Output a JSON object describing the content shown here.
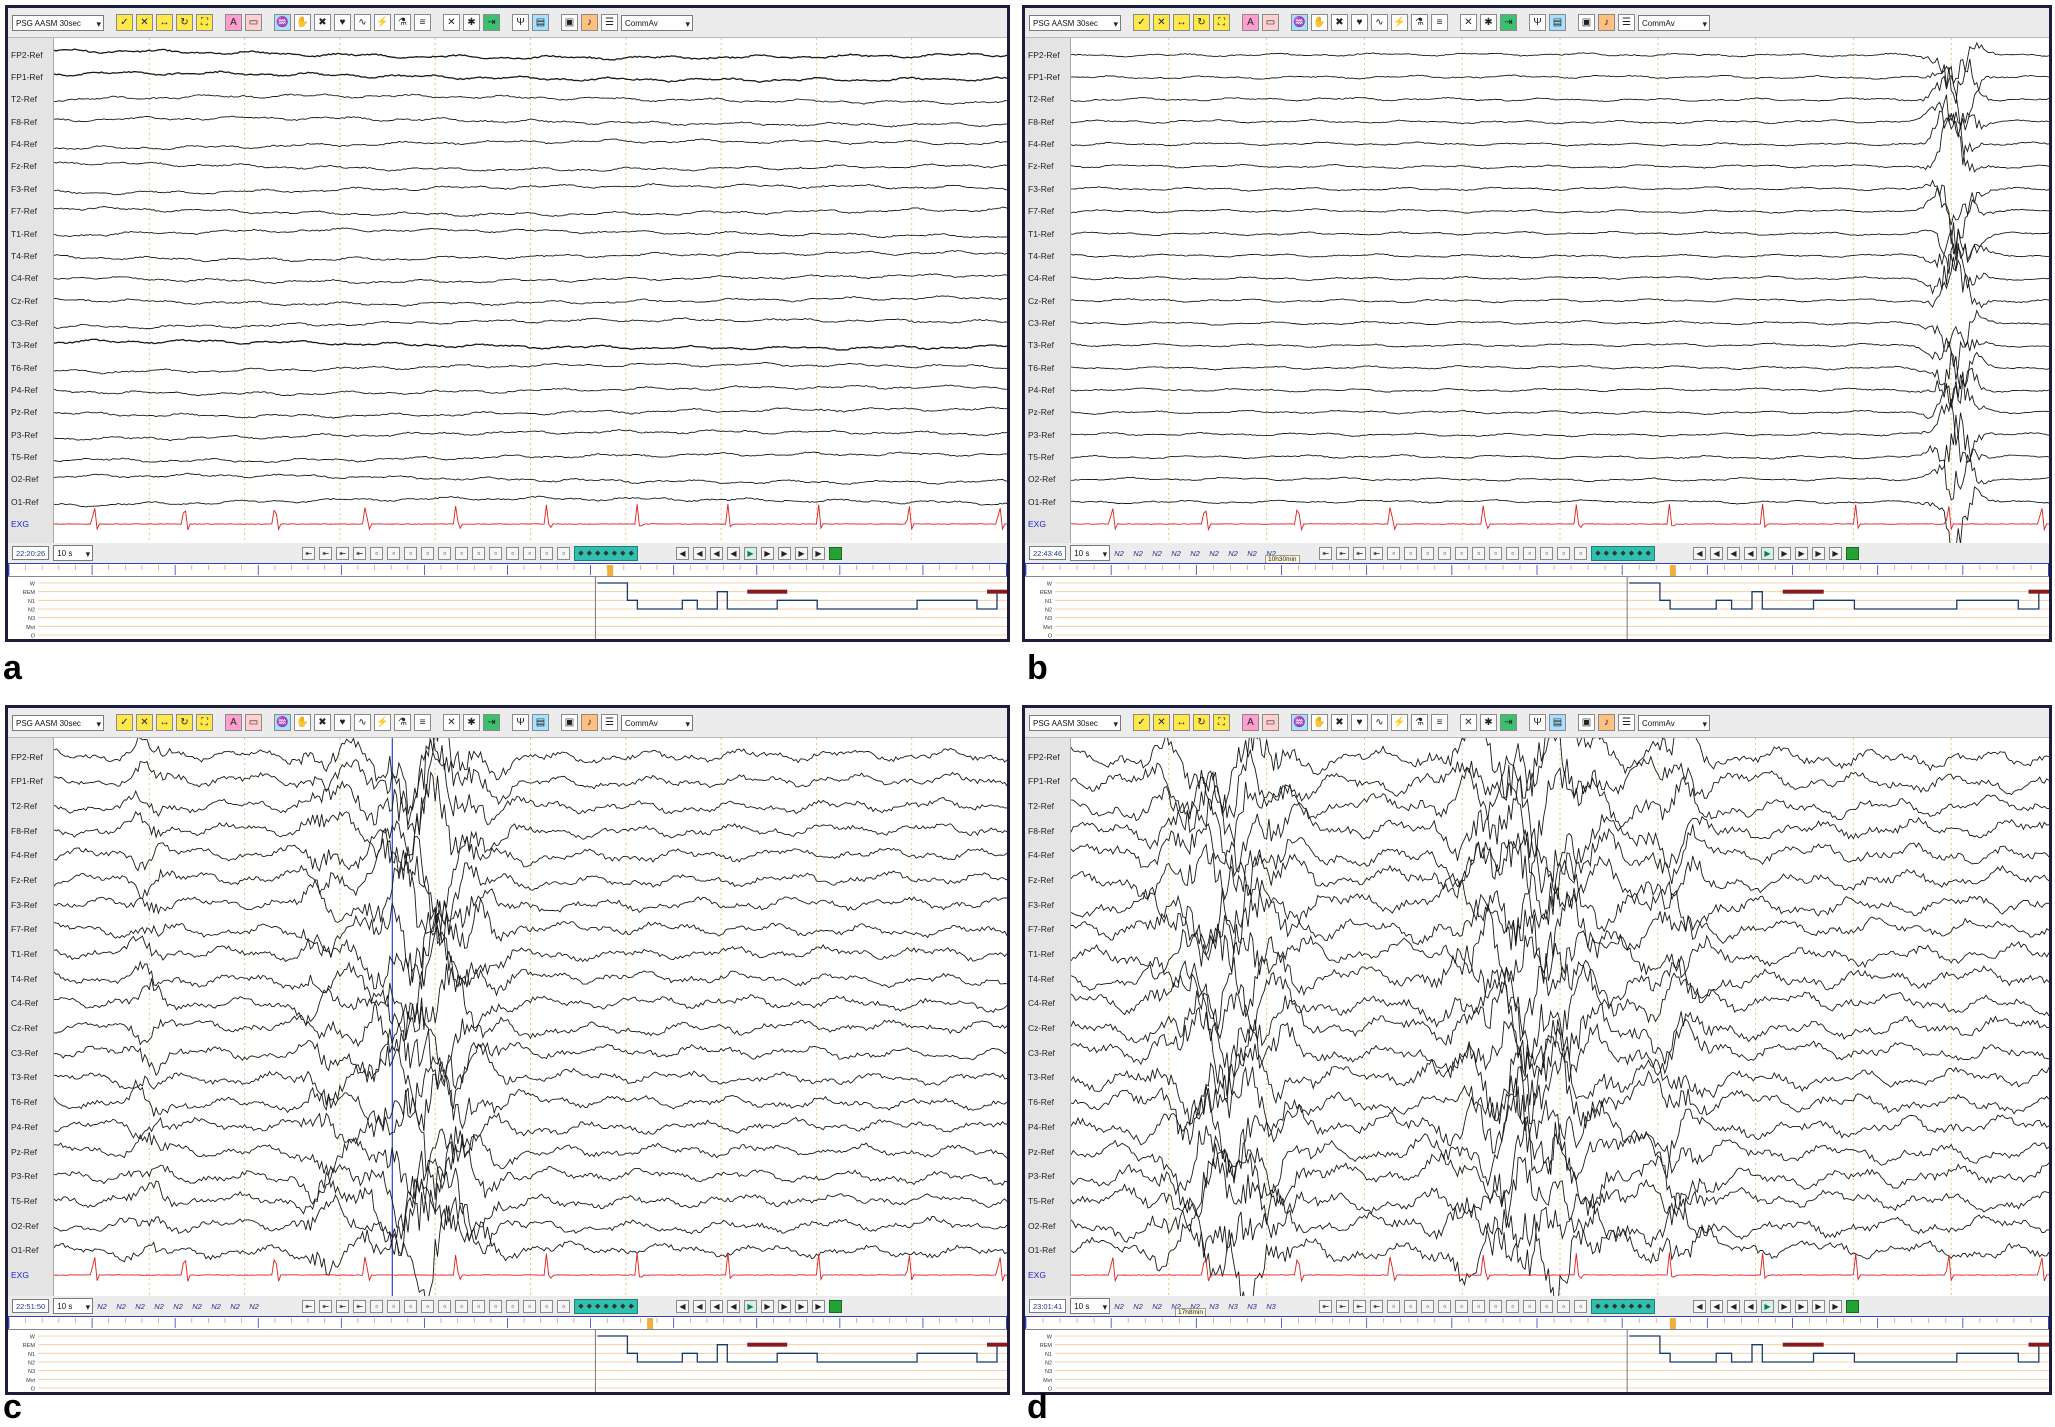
{
  "toolbar": {
    "montage": "PSG AASM 30sec",
    "comment": "CommAv"
  },
  "channels": [
    "FP2-Ref",
    "FP1-Ref",
    "T2-Ref",
    "F8-Ref",
    "F4-Ref",
    "Fz-Ref",
    "F3-Ref",
    "F7-Ref",
    "T1-Ref",
    "T4-Ref",
    "C4-Ref",
    "Cz-Ref",
    "C3-Ref",
    "T3-Ref",
    "T6-Ref",
    "P4-Ref",
    "Pz-Ref",
    "P3-Ref",
    "T5-Ref",
    "O2-Ref",
    "O1-Ref",
    "EXG"
  ],
  "hypnogram_stages": [
    "W",
    "REM",
    "N1",
    "N2",
    "N3",
    "Mvt",
    "O"
  ],
  "panels": [
    {
      "letter": "a",
      "clock": "22:20:26",
      "epoch": "10 s",
      "stage_labels": [],
      "tooltip": "",
      "ecg_color": "#e02020"
    },
    {
      "letter": "b",
      "clock": "22:43:46",
      "epoch": "10 s",
      "stage_labels": [
        "N2",
        "N2",
        "N2",
        "N2",
        "N2",
        "N2",
        "N2",
        "N2",
        "N2"
      ],
      "tooltip": "10h30min",
      "ecg_color": "#e02020"
    },
    {
      "letter": "c",
      "clock": "22:51:50",
      "epoch": "10 s",
      "stage_labels": [
        "N2",
        "N2",
        "N2",
        "N2",
        "N2",
        "N2",
        "N2",
        "N2",
        "N2"
      ],
      "tooltip": "",
      "ecg_color": "#e02020"
    },
    {
      "letter": "d",
      "clock": "23:01:41",
      "epoch": "10 s",
      "stage_labels": [
        "N2",
        "N2",
        "N2",
        "N2",
        "N2",
        "N3",
        "N3",
        "N3",
        "N3"
      ],
      "tooltip": "17h8min",
      "ecg_color": "#e02020"
    }
  ]
}
